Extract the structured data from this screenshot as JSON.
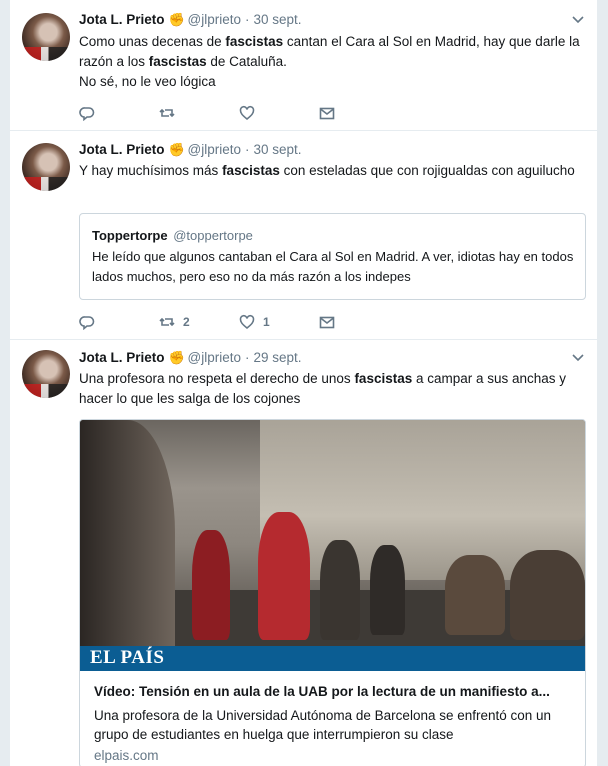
{
  "tweets": [
    {
      "name": "Jota L. Prieto",
      "badge": "✊",
      "handle": "@jlprieto",
      "separator": "·",
      "time": "30 sept.",
      "text_parts": [
        "Como unas decenas de ",
        "fascistas",
        " cantan el Cara al Sol en Madrid, hay que darle la razón a los ",
        "fascistas",
        " de Cataluña."
      ],
      "text_line2": "No sé, no le veo lógica",
      "reply_count": "",
      "retweet_count": "",
      "like_count": ""
    },
    {
      "name": "Jota L. Prieto",
      "badge": "✊",
      "handle": "@jlprieto",
      "separator": "·",
      "time": "30 sept.",
      "text_parts": [
        "Y hay muchísimos más ",
        "fascistas",
        " con esteladas que con rojigualdas con aguilucho"
      ],
      "quote": {
        "name": "Toppertorpe",
        "handle": "@toppertorpe",
        "text": "He leído que algunos cantaban el Cara al Sol en Madrid. A ver, idiotas hay en todos lados muchos, pero eso no da más razón a los indepes"
      },
      "reply_count": "",
      "retweet_count": "2",
      "like_count": "1"
    },
    {
      "name": "Jota L. Prieto",
      "badge": "✊",
      "handle": "@jlprieto",
      "separator": "·",
      "time": "29 sept.",
      "text_parts": [
        "Una profesora no respeta el derecho de unos ",
        "fascistas",
        " a campar a sus anchas y hacer lo que les salga de los cojones"
      ],
      "card": {
        "logo": "EL PAÍS",
        "title": "Vídeo: Tensión en un aula de la UAB por la lectura de un manifiesto a...",
        "description": "Una profesora de la Universidad Autónoma de Barcelona se enfrentó con un grupo de estudiantes en huelga que interrumpieron su clase",
        "domain": "elpais.com"
      }
    }
  ],
  "icons": {
    "reply": "reply-icon",
    "retweet": "retweet-icon",
    "like": "heart-icon",
    "dm": "envelope-icon",
    "caret": "chevron-down-icon"
  },
  "colors": {
    "text": "#14171a",
    "secondary": "#657786",
    "border": "#e6ecf0",
    "elpais_blue": "#0b5d93"
  }
}
